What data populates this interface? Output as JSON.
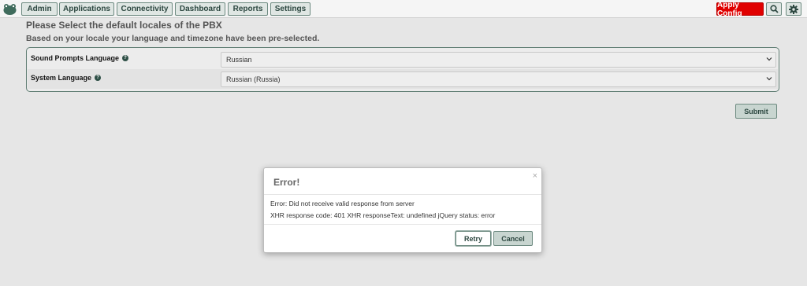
{
  "nav": {
    "items": [
      {
        "label": "Admin"
      },
      {
        "label": "Applications"
      },
      {
        "label": "Connectivity"
      },
      {
        "label": "Dashboard"
      },
      {
        "label": "Reports"
      },
      {
        "label": "Settings"
      }
    ],
    "apply_label": "Apply Config",
    "search_icon": "search-icon",
    "settings_icon": "gear-icon",
    "logo_icon": "frog-logo-icon"
  },
  "page": {
    "title": "Please Select the default locales of the PBX",
    "subtitle": "Based on your locale your language and timezone have been pre-selected."
  },
  "form": {
    "rows": [
      {
        "label": "Sound Prompts Language",
        "value": "Russian"
      },
      {
        "label": "System Language",
        "value": "Russian (Russia)"
      }
    ],
    "help_glyph": "?",
    "submit_label": "Submit"
  },
  "modal": {
    "title": "Error!",
    "close_glyph": "×",
    "message_1": "Error: Did not receive valid response from server",
    "message_2": "XHR response code: 401 XHR responseText: undefined jQuery status: error",
    "retry_label": "Retry",
    "cancel_label": "Cancel"
  },
  "colors": {
    "accent": "#2c4740",
    "apply": "#e00000",
    "button_bg": "#dfe6e3"
  }
}
